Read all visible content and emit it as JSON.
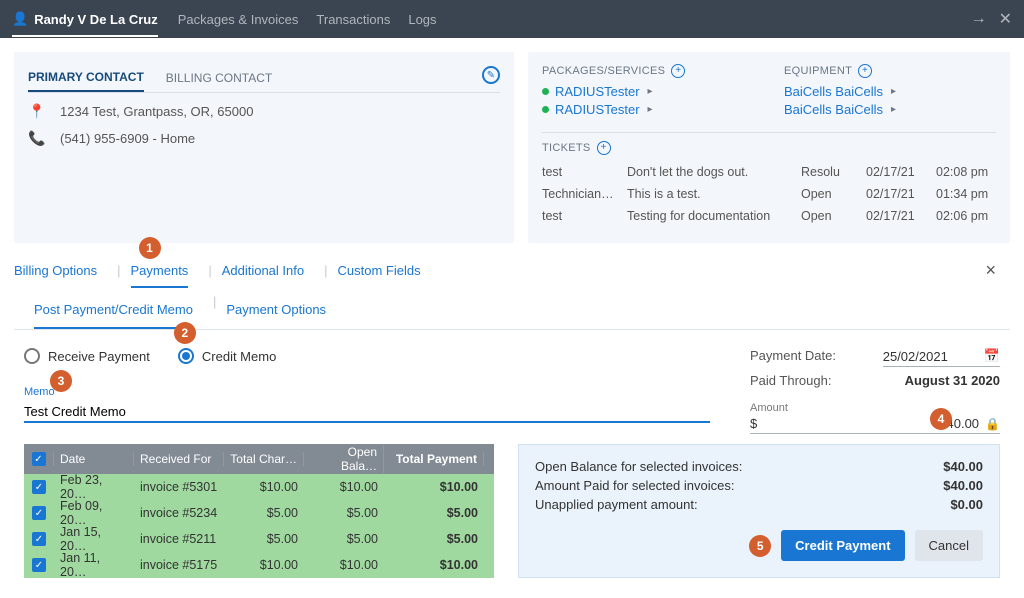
{
  "topbar": {
    "customer_name": "Randy V De La Cruz",
    "nav": [
      "Packages & Invoices",
      "Transactions",
      "Logs"
    ]
  },
  "contact": {
    "tabs": {
      "primary": "PRIMARY CONTACT",
      "billing": "BILLING CONTACT"
    },
    "address": "1234 Test, Grantpass, OR, 65000",
    "phone": "(541) 955-6909 - Home"
  },
  "right_panel": {
    "packages_label": "PACKAGES/SERVICES",
    "equipment_label": "EQUIPMENT",
    "services": [
      "RADIUSTester",
      "RADIUSTester"
    ],
    "equipment": [
      "BaiCells BaiCells",
      "BaiCells BaiCells"
    ],
    "tickets_label": "TICKETS",
    "tickets": [
      {
        "c1": "test",
        "c2": "Don't let the dogs out.",
        "c3": "Resolu",
        "c4": "02/17/21",
        "c5": "02:08 pm"
      },
      {
        "c1": "Technician …",
        "c2": "This is a test.",
        "c3": "Open",
        "c4": "02/17/21",
        "c5": "01:34 pm"
      },
      {
        "c1": "test",
        "c2": "Testing for documentation",
        "c3": "Open",
        "c4": "02/17/21",
        "c5": "02:06 pm"
      }
    ]
  },
  "subtabs": {
    "billing_options": "Billing Options",
    "payments": "Payments",
    "additional_info": "Additional Info",
    "custom_fields": "Custom Fields"
  },
  "subsubtabs": {
    "post_payment": "Post Payment/Credit Memo",
    "payment_options": "Payment Options"
  },
  "payment_form": {
    "receive_label": "Receive Payment",
    "credit_label": "Credit Memo",
    "memo_label": "Memo",
    "memo_value": "Test Credit Memo",
    "payment_date_label": "Payment Date:",
    "payment_date_value": "25/02/2021",
    "paid_through_label": "Paid Through:",
    "paid_through_value": "August 31 2020",
    "amount_label": "Amount",
    "currency": "$",
    "amount_value": "40.00"
  },
  "table": {
    "headers": {
      "date": "Date",
      "recv": "Received For",
      "tot": "Total Char…",
      "open": "Open Bala…",
      "pay": "Total Payment"
    },
    "rows": [
      {
        "date": "Feb 23, 20…",
        "recv": "invoice #5301",
        "tot": "$10.00",
        "open": "$10.00",
        "pay": "$10.00"
      },
      {
        "date": "Feb 09, 20…",
        "recv": "invoice #5234",
        "tot": "$5.00",
        "open": "$5.00",
        "pay": "$5.00"
      },
      {
        "date": "Jan 15, 20…",
        "recv": "invoice #5211",
        "tot": "$5.00",
        "open": "$5.00",
        "pay": "$5.00"
      },
      {
        "date": "Jan 11, 20…",
        "recv": "invoice #5175",
        "tot": "$10.00",
        "open": "$10.00",
        "pay": "$10.00"
      }
    ]
  },
  "summary": {
    "open_balance_label": "Open Balance for selected invoices:",
    "open_balance_value": "$40.00",
    "amount_paid_label": "Amount Paid for selected invoices:",
    "amount_paid_value": "$40.00",
    "unapplied_label": "Unapplied payment amount:",
    "unapplied_value": "$0.00",
    "credit_btn": "Credit Payment",
    "cancel_btn": "Cancel"
  },
  "markers": {
    "m1": "1",
    "m2": "2",
    "m3": "3",
    "m4": "4",
    "m5": "5"
  }
}
